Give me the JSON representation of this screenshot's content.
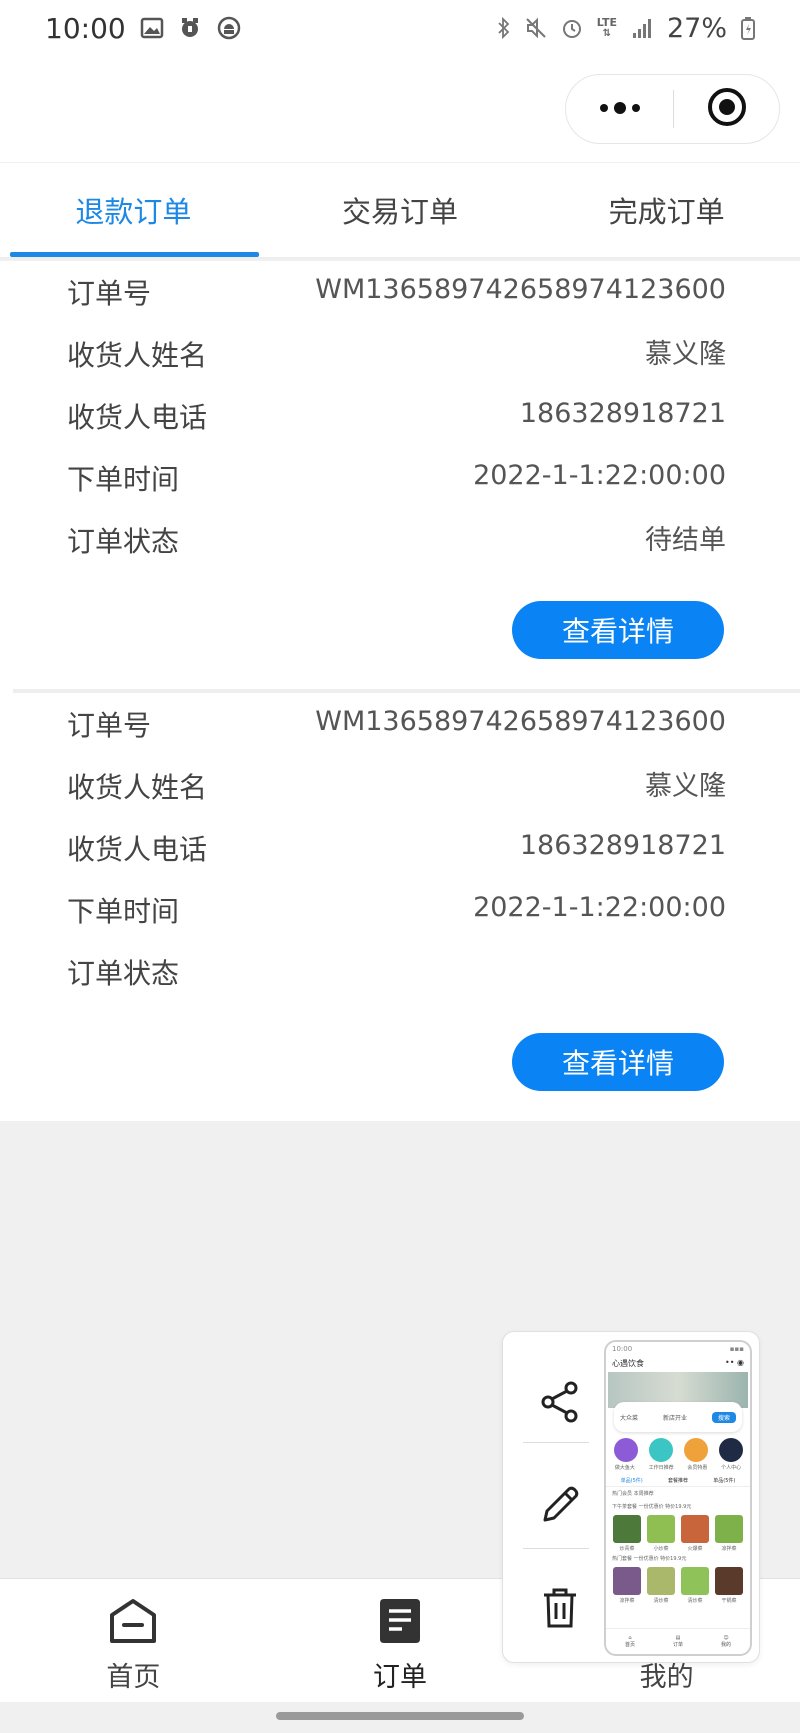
{
  "status_bar": {
    "time": "10:00",
    "battery_percent": "27%",
    "network": "LTE",
    "left_icons": [
      "image-icon",
      "alarm-app-icon",
      "android-icon"
    ],
    "right_icons": [
      "bluetooth-icon",
      "mute-icon",
      "alarm-icon",
      "signal-icon",
      "battery-icon"
    ]
  },
  "capsule": {
    "more_icon": "more-dots-icon",
    "close_icon": "target-close-icon"
  },
  "tabs": [
    {
      "label": "退款订单",
      "active": true
    },
    {
      "label": "交易订单",
      "active": false
    },
    {
      "label": "完成订单",
      "active": false
    }
  ],
  "orders": [
    {
      "fields": [
        {
          "label": "订单号",
          "value": "WM136589742658974123600"
        },
        {
          "label": "收货人姓名",
          "value": "慕义隆"
        },
        {
          "label": "收货人电话",
          "value": "186328918721"
        },
        {
          "label": "下单时间",
          "value": "2022-1-1:22:00:00"
        },
        {
          "label": "订单状态",
          "value": "待结单"
        }
      ],
      "button_label": "查看详情"
    },
    {
      "fields": [
        {
          "label": "订单号",
          "value": "WM136589742658974123600"
        },
        {
          "label": "收货人姓名",
          "value": "慕义隆"
        },
        {
          "label": "收货人电话",
          "value": "186328918721"
        },
        {
          "label": "下单时间",
          "value": "2022-1-1:22:00:00"
        },
        {
          "label": "订单状态",
          "value": ""
        }
      ],
      "button_label": "查看详情"
    }
  ],
  "bottom_nav": [
    {
      "label": "首页",
      "icon": "home-icon",
      "active": false
    },
    {
      "label": "订单",
      "icon": "order-icon",
      "active": true
    },
    {
      "label": "我的",
      "icon": "profile-icon",
      "active": false
    }
  ],
  "float_panel": {
    "tools": [
      "share-icon",
      "edit-icon",
      "delete-icon"
    ],
    "thumbnail": {
      "status_time": "10:00",
      "title": "心遇饮食",
      "search_left": "大众菜",
      "search_mid": "新店开业",
      "search_pill": "搜索",
      "icons": [
        "做大鱼大",
        "工作日推荐",
        "会员特惠",
        "个人中心"
      ],
      "tabs": [
        "单品(5件)",
        "套餐推荐",
        "单品(5件)"
      ],
      "text1": "热门会员 本周推荐",
      "text2": "下午茶套餐 一份优惠价 特价19.9元",
      "foods1": [
        "炒青菜",
        "小炒菜",
        "火爆菜",
        "凉拌菜"
      ],
      "text3": "热门套餐 一份优惠价 特价19.9元",
      "foods2": [
        "凉拌菜",
        "清炒菜",
        "清炒菜",
        "干锅菜"
      ],
      "nav": [
        "首页",
        "订单",
        "我的"
      ]
    }
  },
  "colors": {
    "accent": "#1e88e5",
    "button": "#0a84f5",
    "background": "#f0f0f0"
  }
}
